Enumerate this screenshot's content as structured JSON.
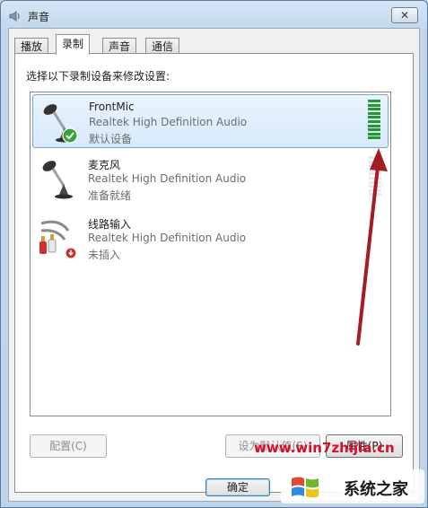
{
  "window": {
    "title": "声音",
    "close_glyph": "✕"
  },
  "tabs": [
    {
      "label": "播放",
      "active": false
    },
    {
      "label": "录制",
      "active": true
    },
    {
      "label": "声音",
      "active": false
    },
    {
      "label": "通信",
      "active": false
    }
  ],
  "panel": {
    "instruction": "选择以下录制设备来修改设置:"
  },
  "devices": [
    {
      "name": "FrontMic",
      "driver": "Realtek High Definition Audio",
      "status": "默认设备",
      "icon": "microphone-icon",
      "badge": "check-badge-icon",
      "level": 1.0,
      "selected": true
    },
    {
      "name": "麦克风",
      "driver": "Realtek High Definition Audio",
      "status": "准备就绪",
      "icon": "microphone-icon",
      "badge": "",
      "level": 0.0,
      "selected": false
    },
    {
      "name": "线路输入",
      "driver": "Realtek High Definition Audio",
      "status": "未插入",
      "icon": "line-in-cable-icon",
      "badge": "unplugged-badge-icon",
      "level": null,
      "selected": false
    }
  ],
  "buttons": {
    "configure": "配置(C)",
    "set_default": "设为默认值(S)",
    "properties": "属性(P)",
    "ok": "确定"
  },
  "watermark": {
    "url": "www.win7zhijia.cn",
    "logo_text": "系统之家"
  },
  "colors": {
    "meter_active": "#1f9a2e",
    "meter_idle": "#e4eaef",
    "annotation_arrow": "#a51c24",
    "selection_border": "#7da2ce"
  }
}
